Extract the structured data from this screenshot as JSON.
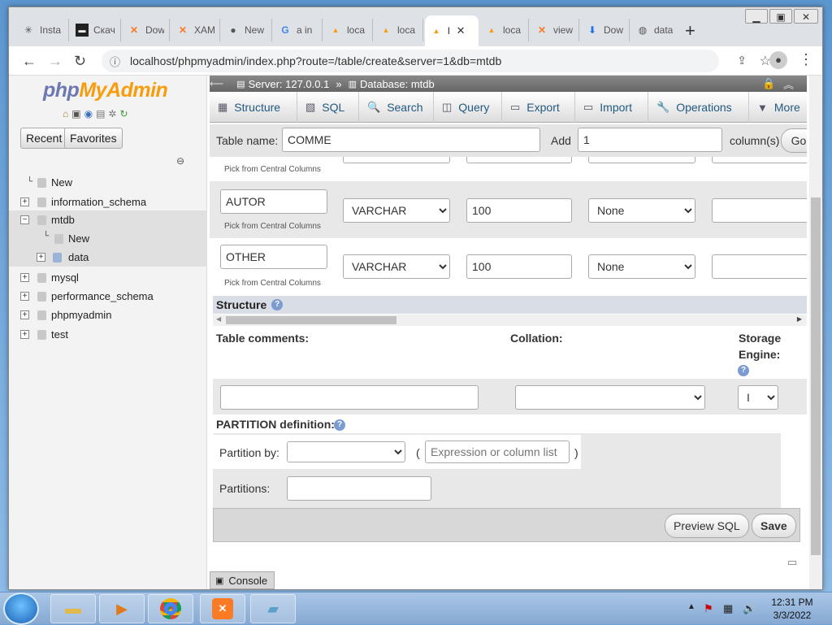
{
  "browser": {
    "tabs": [
      {
        "label": "Insta",
        "icon": "settings-icon"
      },
      {
        "label": "Скач",
        "icon": "terminal-icon"
      },
      {
        "label": "Dow",
        "icon": "xampp-icon"
      },
      {
        "label": "XAM",
        "icon": "xampp-icon"
      },
      {
        "label": "New",
        "icon": "github-icon"
      },
      {
        "label": "a in",
        "icon": "google-icon"
      },
      {
        "label": "loca",
        "icon": "pma-icon"
      },
      {
        "label": "loca",
        "icon": "pma-icon"
      },
      {
        "label": "l",
        "icon": "pma-icon",
        "active": true
      },
      {
        "label": "loca",
        "icon": "pma-icon"
      },
      {
        "label": "view",
        "icon": "xampp-icon"
      },
      {
        "label": "Dow",
        "icon": "download-icon"
      },
      {
        "label": "data",
        "icon": "globe-icon"
      }
    ],
    "new_tab": "+",
    "url": "localhost/phpmyadmin/index.php?route=/table/create&server=1&db=mtdb"
  },
  "sidebar": {
    "logo_php": "php",
    "logo_myadmin": "MyAdmin",
    "recent_label": "Recent",
    "favorites_label": "Favorites",
    "tree": [
      {
        "label": "New",
        "level": 0
      },
      {
        "label": "information_schema",
        "level": 0
      },
      {
        "label": "mtdb",
        "level": 0,
        "expanded": true
      },
      {
        "label": "New",
        "level": 1
      },
      {
        "label": "data",
        "level": 1
      },
      {
        "label": "mysql",
        "level": 0
      },
      {
        "label": "performance_schema",
        "level": 0
      },
      {
        "label": "phpmyadmin",
        "level": 0
      },
      {
        "label": "test",
        "level": 0
      }
    ]
  },
  "breadcrumb": {
    "server": "Server: 127.0.0.1",
    "sep": "»",
    "database": "Database: mtdb"
  },
  "menu": [
    "Structure",
    "SQL",
    "Search",
    "Query",
    "Export",
    "Import",
    "Operations",
    "More"
  ],
  "form": {
    "table_name_label": "Table name:",
    "table_name_value": "COMME",
    "add_label": "Add",
    "add_value": "1",
    "columns_label": "column(s)",
    "go_label": "Go",
    "pick_from_central": "Pick from Central Columns",
    "columns": [
      {
        "name": "AUTOR",
        "type": "VARCHAR",
        "length": "100",
        "default": "None"
      },
      {
        "name": "OTHER",
        "type": "VARCHAR",
        "length": "100",
        "default": "None"
      }
    ],
    "structure_label": "Structure",
    "table_comments_label": "Table comments:",
    "collation_label": "Collation:",
    "storage_engine_label_1": "Storage",
    "storage_engine_label_2": "Engine:",
    "storage_engine_value": "I",
    "partition_label": "PARTITION definition:",
    "partition_by_label": "Partition by:",
    "open_paren": "(",
    "close_paren": ")",
    "expression_placeholder": "Expression or column list",
    "partitions_label": "Partitions:",
    "preview_sql_label": "Preview SQL",
    "save_label": "Save",
    "console_label": "Console"
  },
  "taskbar": {
    "time": "12:31 PM",
    "date": "3/3/2022"
  }
}
